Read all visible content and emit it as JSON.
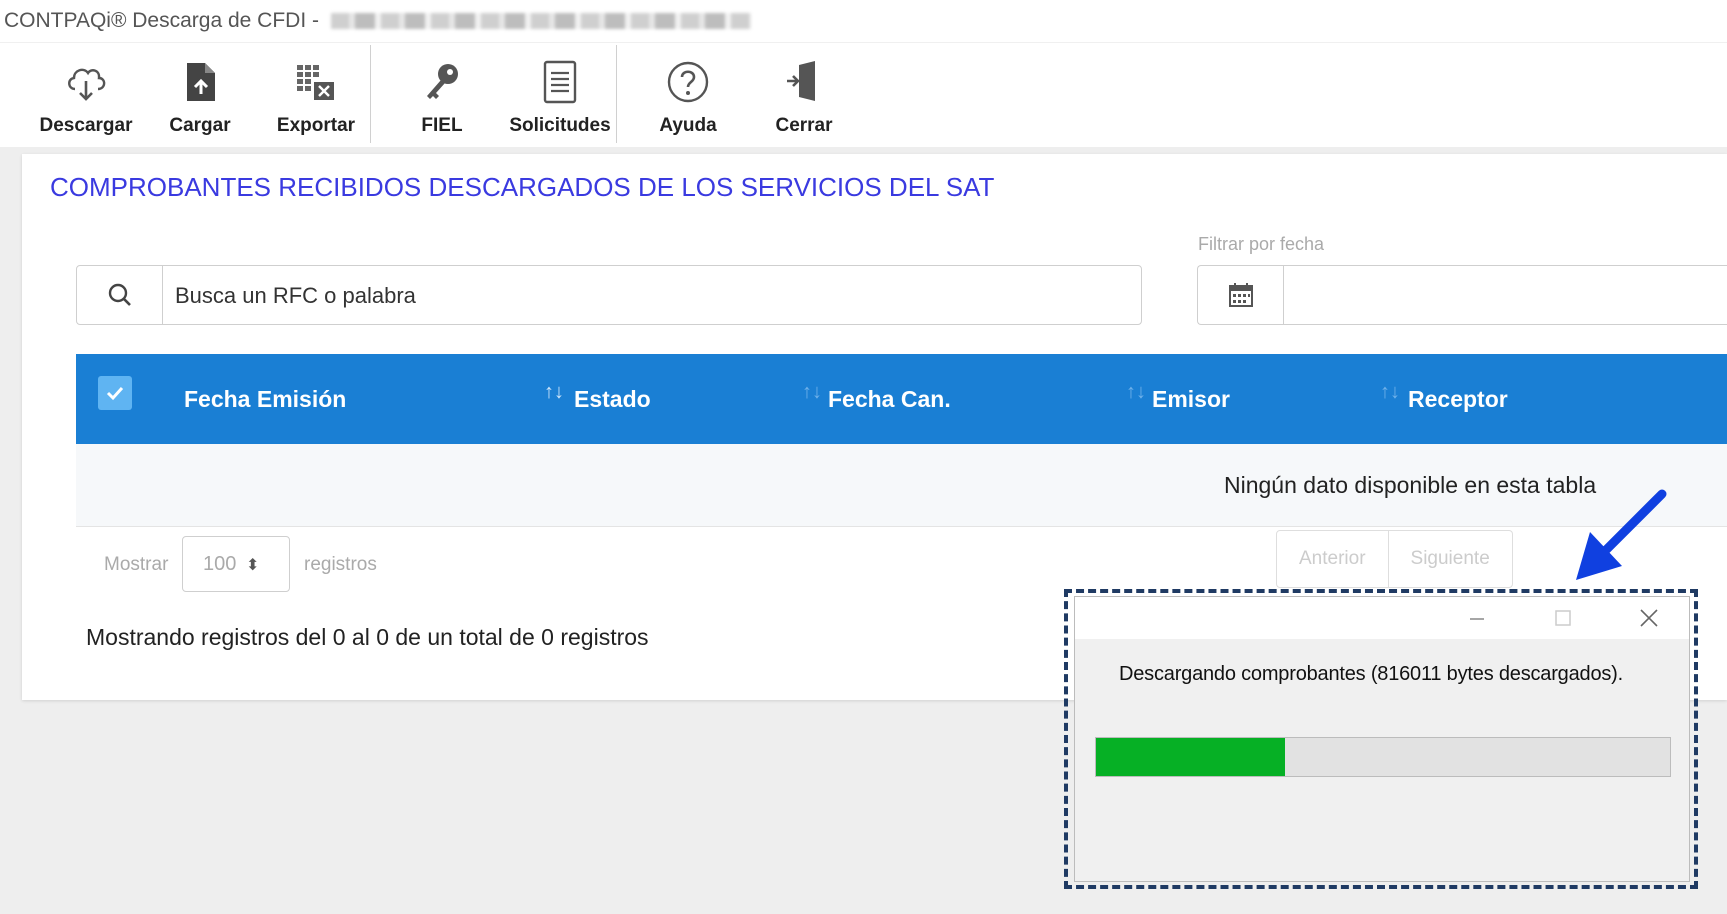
{
  "window": {
    "title": "CONTPAQi® Descarga de CFDI - "
  },
  "toolbar": {
    "buttons": [
      {
        "label": "Descargar",
        "icon": "cloud-download-icon"
      },
      {
        "label": "Cargar",
        "icon": "file-upload-icon"
      },
      {
        "label": "Exportar",
        "icon": "excel-export-icon"
      },
      {
        "label": "FIEL",
        "icon": "key-icon"
      },
      {
        "label": "Solicitudes",
        "icon": "document-list-icon"
      },
      {
        "label": "Ayuda",
        "icon": "help-circle-icon"
      },
      {
        "label": "Cerrar",
        "icon": "exit-door-icon"
      }
    ]
  },
  "main": {
    "title": "COMPROBANTES RECIBIDOS DESCARGADOS DE LOS SERVICIOS DEL SAT",
    "title_color": "#3a3ae0",
    "search": {
      "placeholder": "Busca un RFC o palabra",
      "value": ""
    },
    "date_filter": {
      "label": "Filtrar por fecha",
      "value": ""
    }
  },
  "table": {
    "header_color": "#1a7fd4",
    "columns": [
      "Fecha Emisión",
      "Estado",
      "Fecha Can.",
      "Emisor",
      "Receptor"
    ],
    "empty_message": "Ningún dato disponible en esta tabla",
    "rows": []
  },
  "pagination": {
    "show_label": "Mostrar",
    "page_size": "100",
    "records_label": "registros",
    "prev_label": "Anterior",
    "next_label": "Siguiente",
    "summary": "Mostrando registros del 0 al 0 de un total de 0 registros"
  },
  "progress_dialog": {
    "message": "Descargando comprobantes (816011 bytes descargados).",
    "progress_fraction": 0.33,
    "progress_color": "#06b025"
  }
}
